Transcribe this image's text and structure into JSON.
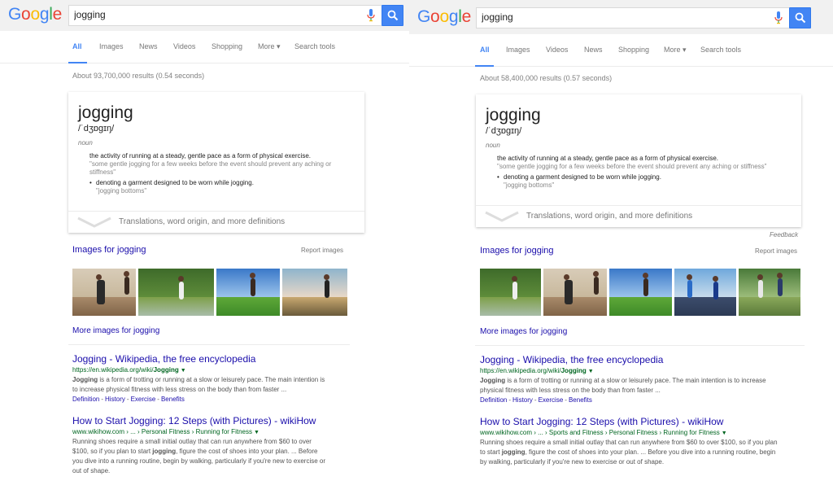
{
  "left": {
    "logo": "Google",
    "search": {
      "value": "jogging",
      "placeholder": ""
    },
    "tabs": [
      {
        "label": "All",
        "active": true
      },
      {
        "label": "Images"
      },
      {
        "label": "News"
      },
      {
        "label": "Videos"
      },
      {
        "label": "Shopping"
      },
      {
        "label": "More ▾"
      },
      {
        "label": "Search tools"
      }
    ],
    "stats": "About 93,700,000 results (0.54 seconds)",
    "dict": {
      "word": "jogging",
      "phonetic": "/ˈdʒɒɡɪŋ/",
      "pos": "noun",
      "def1": "the activity of running at a steady, gentle pace as a form of physical exercise.",
      "ex1a": "\"some gentle jogging for a few weeks before the event should prevent any aching or",
      "ex1b": "stiffness\"",
      "def2": "denoting a garment designed to be worn while jogging.",
      "ex2": "\"jogging bottoms\"",
      "more": "Translations, word origin, and more definitions"
    },
    "images_title": "Images for jogging",
    "report": "Report images",
    "more_images": "More images for jogging",
    "results": [
      {
        "title": "Jogging - Wikipedia, the free encyclopedia",
        "url_prefix": "https://en.wikipedia.org/wiki/",
        "url_bold": "Jogging",
        "snippet_bold": "Jogging",
        "snippet_1": " is a form of trotting or running at a slow or leisurely pace. The main intention is",
        "snippet_2": "to increase physical fitness with less stress on the body than from faster ...",
        "sitelinks": [
          "Definition",
          "History",
          "Exercise",
          "Benefits"
        ]
      },
      {
        "title": "How to Start Jogging: 12 Steps (with Pictures) - wikiHow",
        "url": "www.wikihow.com › ... › Personal Fitness › Running for Fitness",
        "snippet_1": "Running shoes require a small initial outlay that can run anywhere from $60 to over",
        "snippet_2a": "$100, so if you plan to start ",
        "snippet_2b": "jogging",
        "snippet_2c": ", figure the cost of shoes into your plan. ... Before",
        "snippet_3": "you dive into a running routine, begin by walking, particularly if you're new to exercise or",
        "snippet_4": "out of shape."
      }
    ]
  },
  "right": {
    "logo": "Google",
    "search": {
      "value": "jogging",
      "placeholder": ""
    },
    "tabs": [
      {
        "label": "All",
        "active": true
      },
      {
        "label": "Images"
      },
      {
        "label": "Videos"
      },
      {
        "label": "News"
      },
      {
        "label": "Shopping"
      },
      {
        "label": "More ▾"
      },
      {
        "label": "Search tools"
      }
    ],
    "stats": "About 58,400,000 results (0.57 seconds)",
    "dict": {
      "word": "jogging",
      "phonetic": "/ˈdʒɒɡɪŋ/",
      "pos": "noun",
      "def1": "the activity of running at a steady, gentle pace as a form of physical exercise.",
      "ex1": "\"some gentle jogging for a few weeks before the event should prevent any aching or stiffness\"",
      "def2": "denoting a garment designed to be worn while jogging.",
      "ex2": "\"jogging bottoms\"",
      "more": "Translations, word origin, and more definitions"
    },
    "feedback": "Feedback",
    "images_title": "Images for jogging",
    "report": "Report images",
    "more_images": "More images for jogging",
    "results": [
      {
        "title": "Jogging - Wikipedia, the free encyclopedia",
        "url_prefix": "https://en.wikipedia.org/wiki/",
        "url_bold": "Jogging",
        "snippet_bold": "Jogging",
        "snippet_1": " is a form of trotting or running at a slow or leisurely pace. The main intention is to increase",
        "snippet_2": "physical fitness with less stress on the body than from faster ...",
        "sitelinks": [
          "Definition",
          "History",
          "Exercise",
          "Benefits"
        ]
      },
      {
        "title": "How to Start Jogging: 12 Steps (with Pictures) - wikiHow",
        "url": "www.wikihow.com › ... › Sports and Fitness › Personal Fitness › Running for Fitness",
        "snippet_1": "Running shoes require a small initial outlay that can run anywhere from $60 to over $100, so if you plan",
        "snippet_2a": "to start ",
        "snippet_2b": "jogging",
        "snippet_2c": ", figure the cost of shoes into your plan. ... Before you dive into a running routine, begin",
        "snippet_3": "by walking, particularly if you're new to exercise or out of shape."
      }
    ]
  },
  "colors": {
    "link": "#1a0dab",
    "url": "#006621",
    "accent": "#4285f4",
    "snippet": "#545454"
  },
  "icons": [
    "microphone-icon",
    "search-icon",
    "chevron-down-icon"
  ]
}
